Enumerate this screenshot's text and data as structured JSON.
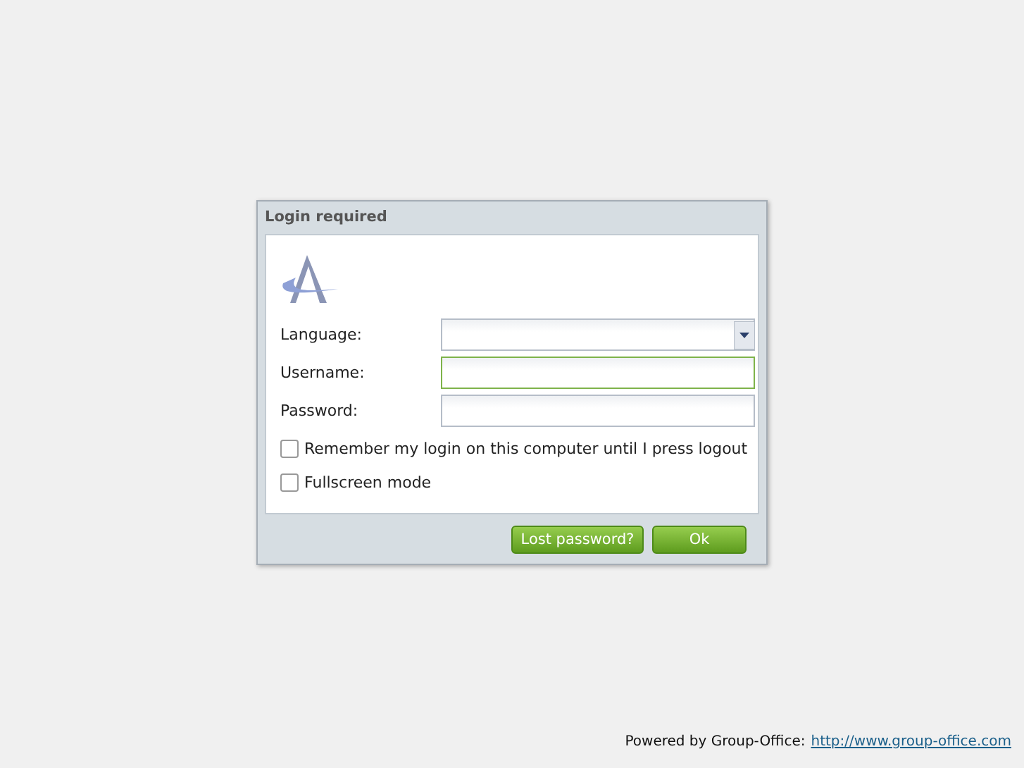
{
  "dialog": {
    "title": "Login required",
    "fields": [
      {
        "kind": "select",
        "label": "Language:",
        "focused": false
      },
      {
        "kind": "text",
        "label": "Username:",
        "focused": true
      },
      {
        "kind": "password",
        "label": "Password:",
        "focused": false
      }
    ],
    "checkboxes": [
      {
        "label": "Remember my login on this computer until I press logout",
        "checked": false
      },
      {
        "label": "Fullscreen mode",
        "checked": false
      }
    ],
    "buttons": [
      "Lost password?",
      "Ok"
    ]
  },
  "footer": {
    "text": "Powered by Group-Office:",
    "link": "http://www.group-office.com"
  }
}
